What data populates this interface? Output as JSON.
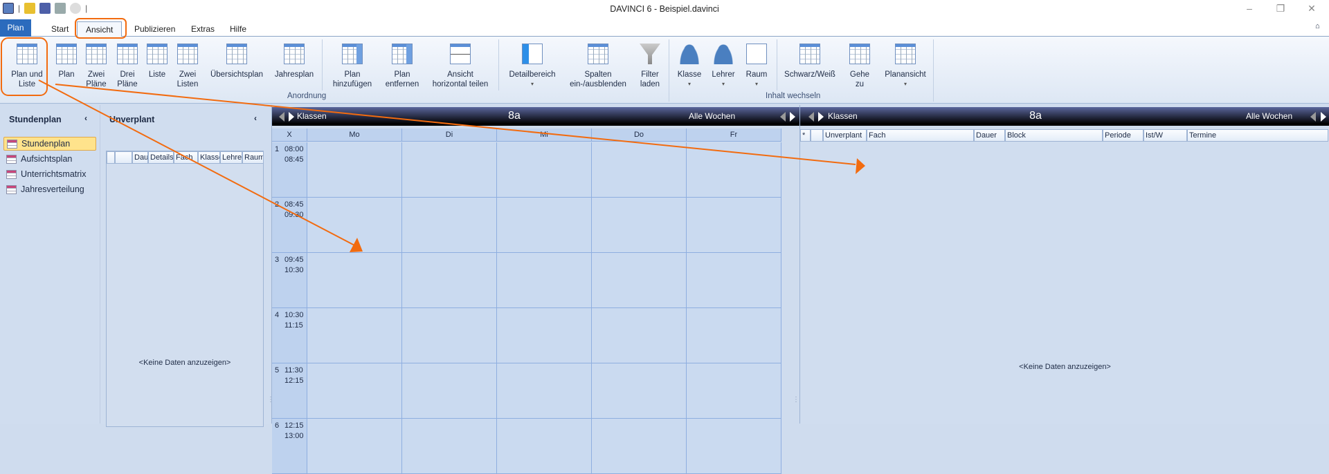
{
  "window": {
    "title": "DAVINCI 6 - Beispiel.davinci",
    "minimize": "–",
    "restore": "❐",
    "close": "✕",
    "collapse_ribbon": "⌂"
  },
  "qat": {
    "icons": [
      "app-icon",
      "open-icon",
      "save-icon",
      "print-icon",
      "refresh-icon"
    ],
    "separator": "|"
  },
  "tabs": [
    "Plan",
    "Start",
    "Ansicht",
    "Publizieren",
    "Extras",
    "Hilfe"
  ],
  "active_tab": "Ansicht",
  "ribbon": {
    "anordnung": {
      "label": "Anordnung",
      "buttons": [
        "Plan und\nListe",
        "Plan",
        "Zwei\nPläne",
        "Drei\nPläne",
        "Liste",
        "Zwei\nListen",
        "Übersichtsplan",
        "Jahresplan",
        "Plan\nhinzufügen",
        "Plan\nentfernen",
        "Ansicht\nhorizontal teilen",
        "Detailbereich",
        "Spalten\nein-/ausblenden",
        "Filter\nladen"
      ]
    },
    "inhalt": {
      "label": "Inhalt wechseln",
      "buttons": [
        "Klasse",
        "Lehrer",
        "Raum",
        "Schwarz/Weiß",
        "Gehe\nzu",
        "Planansicht"
      ]
    },
    "dropdown_arrow": "▾"
  },
  "nav": {
    "title": "Stundenplan",
    "collapse": "‹",
    "items": [
      "Stundenplan",
      "Aufsichtsplan",
      "Unterrichtsmatrix",
      "Jahresverteilung"
    ],
    "selected": "Stundenplan"
  },
  "unverplant": {
    "title": "Unverplant",
    "collapse": "‹",
    "columns": [
      "",
      "",
      "Dau",
      "Details",
      "Fach",
      "Klasse",
      "Lehre",
      "Raum"
    ],
    "empty": "<Keine Daten anzuzeigen>"
  },
  "schedule": {
    "type_label": "Klassen",
    "class": "8a",
    "weeks": "Alle Wochen",
    "corner": "X",
    "days": [
      "Mo",
      "Di",
      "Mi",
      "Do",
      "Fr"
    ],
    "periods": [
      {
        "n": "1",
        "start": "08:00",
        "end": "08:45"
      },
      {
        "n": "2",
        "start": "08:45",
        "end": "09:30"
      },
      {
        "n": "3",
        "start": "09:45",
        "end": "10:30"
      },
      {
        "n": "4",
        "start": "10:30",
        "end": "11:15"
      },
      {
        "n": "5",
        "start": "11:30",
        "end": "12:15"
      },
      {
        "n": "6",
        "start": "12:15",
        "end": "13:00"
      }
    ]
  },
  "list": {
    "type_label": "Klassen",
    "class": "8a",
    "weeks": "Alle Wochen",
    "columns": [
      "*",
      "",
      "Unverplant",
      "Fach",
      "Dauer",
      "Block",
      "Periode",
      "Ist/W",
      "Termine"
    ],
    "empty": "<Keine Daten anzuzeigen>"
  },
  "annotation_color": "#f26b0f"
}
